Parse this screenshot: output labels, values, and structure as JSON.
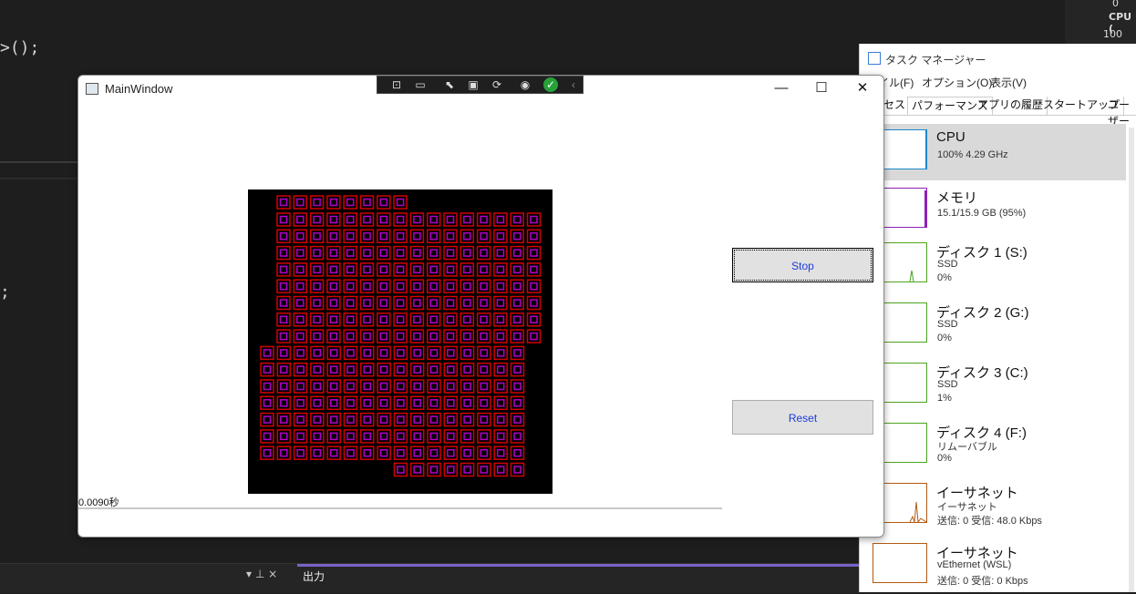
{
  "vs": {
    "code_line1": ">();",
    "code_line2": ";",
    "right_panel": {
      "value0": "0",
      "cpu_label": "CPU (",
      "value100": "100"
    },
    "bottom_panel": {
      "label": "出力",
      "pin": "▾ ⊥ ×"
    }
  },
  "task_manager": {
    "title": "タスク マネージャー",
    "menu": [
      "イル(F)",
      "オプション(O)",
      "表示(V)"
    ],
    "tabs": [
      "セス",
      "パフォーマンス",
      "アプリの履歴",
      "スタートアップ",
      "ユーザー"
    ],
    "active_tab": "パフォーマンス",
    "items": [
      {
        "name": "CPU",
        "line1": "100%  4.29 GHz",
        "line2": "",
        "line3": "",
        "color": "#1a88c9"
      },
      {
        "name": "メモリ",
        "line1": "15.1/15.9 GB (95%)",
        "line2": "",
        "line3": "",
        "color": "#8b22b4"
      },
      {
        "name": "ディスク 1 (S:)",
        "line1": "SSD",
        "line2": "0%",
        "line3": "",
        "color": "#4da31f"
      },
      {
        "name": "ディスク 2 (G:)",
        "line1": "SSD",
        "line2": "0%",
        "line3": "",
        "color": "#4da31f"
      },
      {
        "name": "ディスク 3 (C:)",
        "line1": "SSD",
        "line2": "1%",
        "line3": "",
        "color": "#4da31f"
      },
      {
        "name": "ディスク 4 (F:)",
        "line1": "リムーバブル",
        "line2": "0%",
        "line3": "",
        "color": "#4da31f"
      },
      {
        "name": "イーサネット",
        "line1": "イーサネット",
        "line2": "送信: 0 受信: 48.0 Kbps",
        "line3": "",
        "color": "#b35a10"
      },
      {
        "name": "イーサネット",
        "line1": "vEthernet (WSL)",
        "line2": "送信: 0 受信: 0 Kbps",
        "line3": "",
        "color": "#b35a10"
      }
    ]
  },
  "main_window": {
    "title": "MainWindow",
    "minimize": "—",
    "maximize": "☐",
    "close": "✕",
    "stop_label": "Stop",
    "reset_label": "Reset",
    "elapsed": "0.0090秒",
    "colors": {
      "canvas_bg": "#000000",
      "cell_outer": "#d10000",
      "cell_inner": "#b000c8"
    }
  },
  "debug_toolbar": {
    "icons": [
      "select-element-icon",
      "camera-icon",
      "pointer-icon",
      "layout-icon",
      "hot-reload-icon",
      "broadcast-icon",
      "check-circle-icon",
      "collapse-icon"
    ]
  }
}
